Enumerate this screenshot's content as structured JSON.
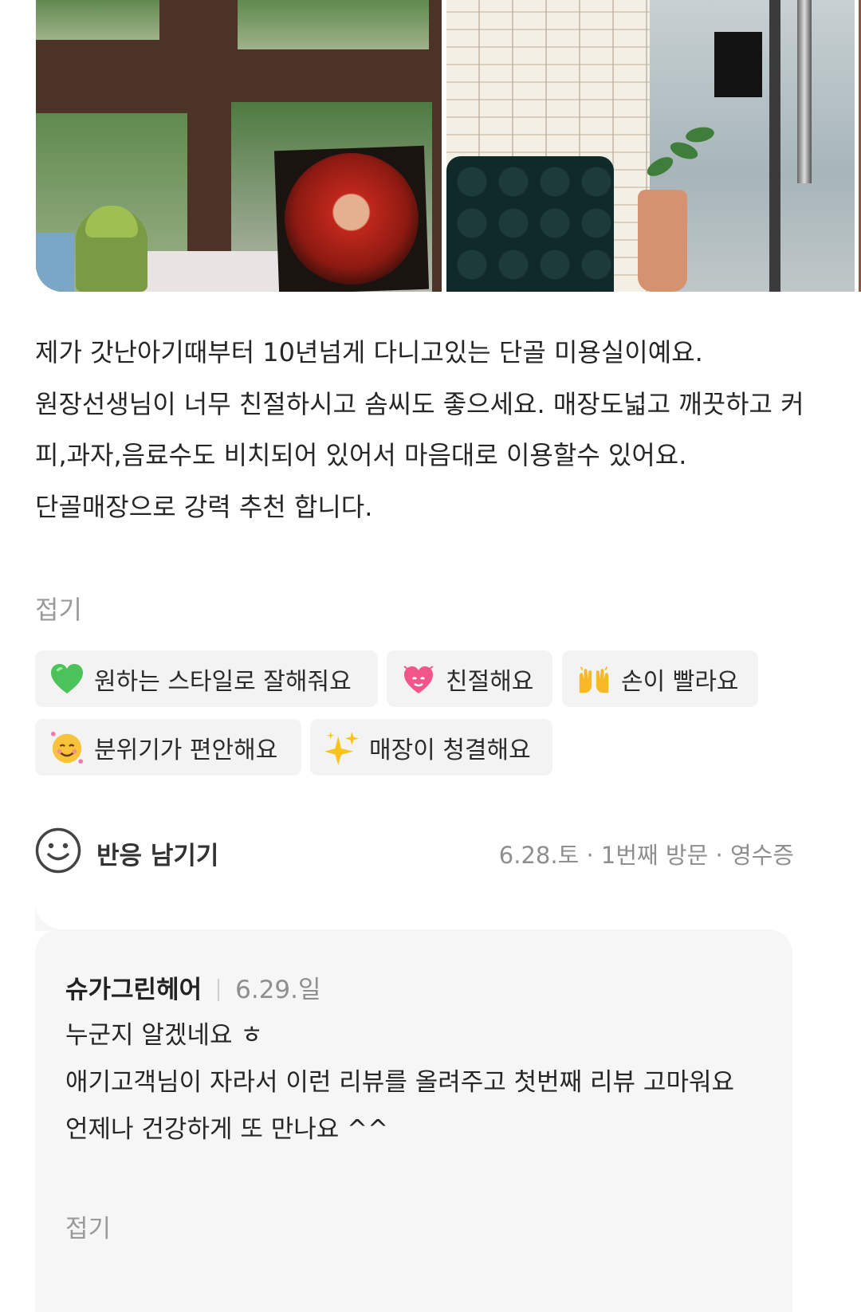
{
  "review": {
    "text": "제가 갓난아기때부터 10년넘게 다니고있는 단골 미용실이예요.\n원장선생님이 너무 친절하시고 솜씨도 좋으세요. 매장도넓고 깨끗하고 커피,과자,음료수도 비치되어 있어서 마음대로 이용할수 있어요.\n단골매장으로 강력 추천 합니다.",
    "fold_label": "접기"
  },
  "keywords": [
    {
      "icon": "green-heart-icon",
      "label": "원하는 스타일로 잘해줘요"
    },
    {
      "icon": "beating-heart-icon",
      "label": "친절해요"
    },
    {
      "icon": "raising-hands-icon",
      "label": "손이 빨라요"
    },
    {
      "icon": "smiling-face-icon",
      "label": "분위기가 편안해요"
    },
    {
      "icon": "sparkles-icon",
      "label": "매장이 청결해요"
    }
  ],
  "reaction": {
    "icon": "smile-icon",
    "label": "반응 남기기"
  },
  "meta": "6.28.토 · 1번째 방문 · 영수증",
  "owner_reply": {
    "name": "슈가그린헤어",
    "date": "6.29.일",
    "text": "누군지 알겠네요 ㅎ\n애기고객님이 자라서 이런 리뷰를 올려주고 첫번째 리뷰 고마워요\n언제나 건강하게 또 만나요 ^^",
    "fold_label": "접기"
  }
}
